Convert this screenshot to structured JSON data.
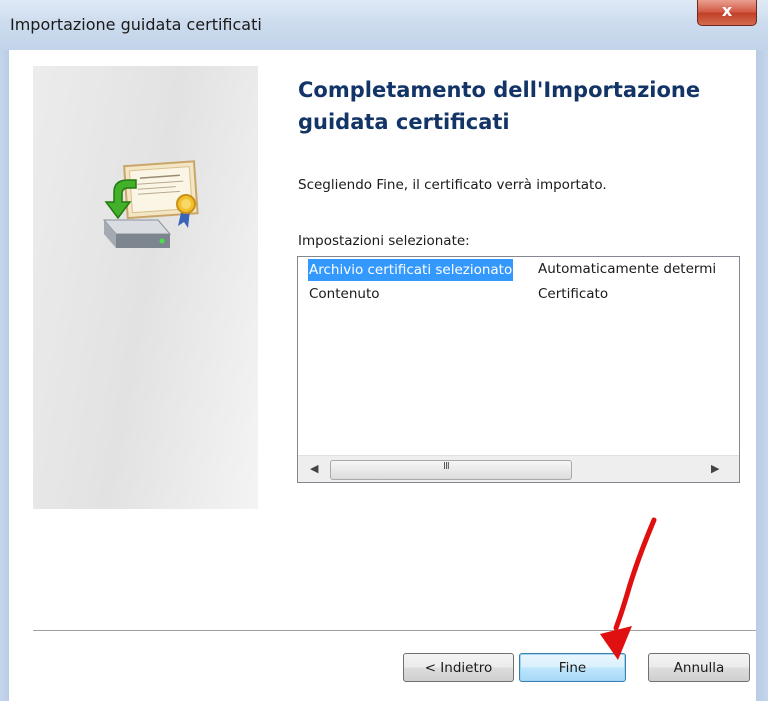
{
  "window": {
    "title": "Importazione guidata certificati",
    "close_glyph": "x"
  },
  "main": {
    "heading": "Completamento dell'Importazione guidata certificati",
    "description": "Scegliendo Fine, il certificato verrà importato.",
    "settings_label": "Impostazioni selezionate:",
    "settings": [
      {
        "name": "Archivio certificati selezionato",
        "value": "Automaticamente determi",
        "selected": true
      },
      {
        "name": "Contenuto",
        "value": "Certificato",
        "selected": false
      }
    ],
    "scrollbar": {
      "thumb_grip": "III"
    }
  },
  "buttons": {
    "back": "< Indietro",
    "finish": "Fine",
    "cancel": "Annulla"
  },
  "icons": {
    "wizard": "certificate-import-icon",
    "annotation": "red-arrow-pointer"
  },
  "colors": {
    "selection": "#3399ff",
    "heading": "#123466",
    "annotation": "#e01010"
  }
}
